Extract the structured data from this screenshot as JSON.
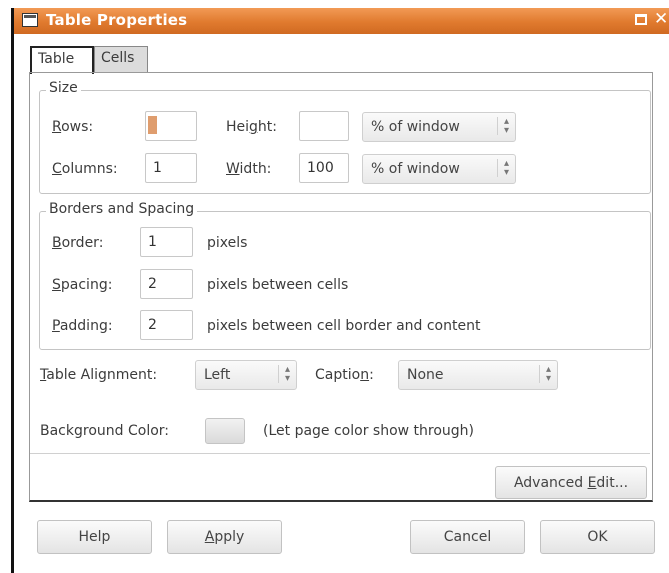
{
  "window": {
    "title": "Table Properties"
  },
  "tabs": [
    {
      "label": "Table"
    },
    {
      "label": "Cells"
    }
  ],
  "size": {
    "legend": "Size",
    "rows_label_pre": "",
    "rows_label_u": "R",
    "rows_label_post": "ows:",
    "rows_value": "1",
    "columns_label_u": "C",
    "columns_label_post": "olumns:",
    "columns_value": "1",
    "height_label_pre": "Hei",
    "height_label_u": "g",
    "height_label_post": "ht:",
    "height_value": "",
    "height_unit": "% of window",
    "width_label_u": "W",
    "width_label_post": "idth:",
    "width_value": "100",
    "width_unit": "% of window"
  },
  "borders": {
    "legend": "Borders and Spacing",
    "border_label_u": "B",
    "border_label_post": "order:",
    "border_value": "1",
    "border_unit": "pixels",
    "spacing_label_u": "S",
    "spacing_label_post": "pacing:",
    "spacing_value": "2",
    "spacing_unit": "pixels between cells",
    "padding_label_u": "P",
    "padding_label_post": "adding:",
    "padding_value": "2",
    "padding_unit": "pixels between cell border and content"
  },
  "alignment": {
    "label_u": "T",
    "label_post": "able Alignment:",
    "value": "Left",
    "caption_label_pre": "Captio",
    "caption_label_u": "n",
    "caption_label_post": ":",
    "caption_value": "None"
  },
  "background": {
    "label": "Background Color:",
    "note": "(Let page color show through)"
  },
  "buttons": {
    "advanced_pre": "Advanced ",
    "advanced_u": "E",
    "advanced_post": "dit...",
    "help": "Help",
    "apply_u": "A",
    "apply_post": "pply",
    "cancel": "Cancel",
    "ok": "OK"
  }
}
